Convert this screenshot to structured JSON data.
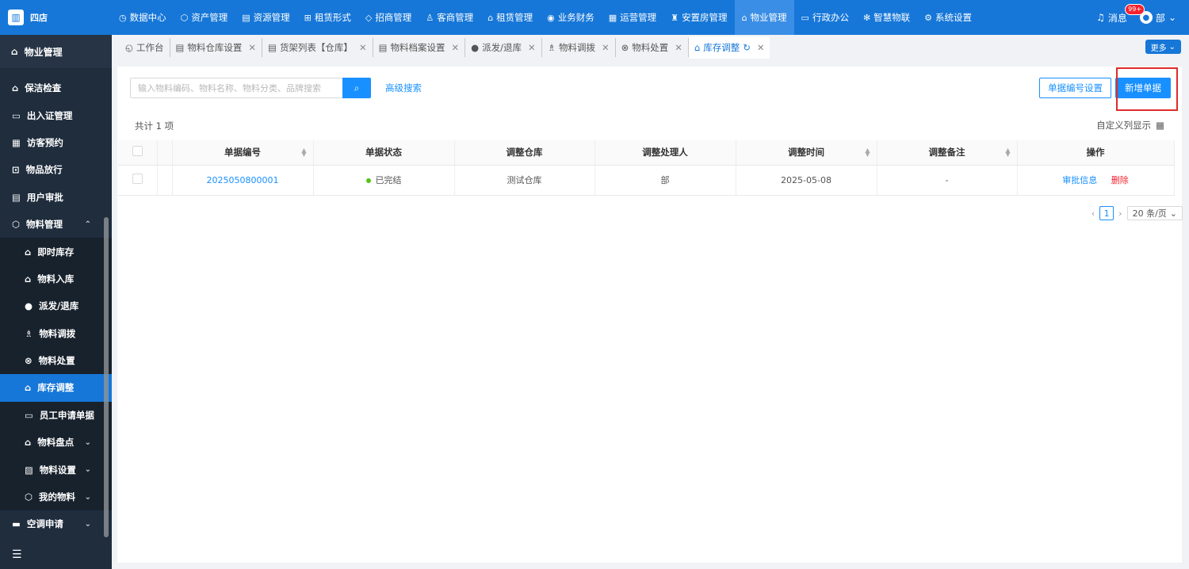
{
  "brand": {
    "name": "四店"
  },
  "nav": {
    "items": [
      {
        "icon": "◷",
        "label": "数据中心"
      },
      {
        "icon": "⬡",
        "label": "资产管理"
      },
      {
        "icon": "▤",
        "label": "资源管理"
      },
      {
        "icon": "⊞",
        "label": "租赁形式"
      },
      {
        "icon": "◇",
        "label": "招商管理"
      },
      {
        "icon": "♙",
        "label": "客商管理"
      },
      {
        "icon": "⌂",
        "label": "租赁管理"
      },
      {
        "icon": "◉",
        "label": "业务财务"
      },
      {
        "icon": "▦",
        "label": "运营管理"
      },
      {
        "icon": "♜",
        "label": "安置房管理"
      },
      {
        "icon": "⌂",
        "label": "物业管理"
      },
      {
        "icon": "▭",
        "label": "行政办公"
      },
      {
        "icon": "✻",
        "label": "智慧物联"
      },
      {
        "icon": "⚙",
        "label": "系统设置"
      }
    ],
    "message_label": "消息",
    "message_badge": "99+",
    "user_name": "部"
  },
  "sidebar": {
    "header": "物业管理",
    "items": [
      {
        "label": "保洁检查",
        "icon": "⌂"
      },
      {
        "label": "出入证管理",
        "icon": "▭"
      },
      {
        "label": "访客预约",
        "icon": "▦"
      },
      {
        "label": "物品放行",
        "icon": "⊡"
      },
      {
        "label": "用户审批",
        "icon": "▤"
      },
      {
        "label": "物料管理",
        "icon": "⬡",
        "chevron": "⌃"
      },
      {
        "label": "即时库存",
        "icon": "⌂"
      },
      {
        "label": "物料入库",
        "icon": "⌂"
      },
      {
        "label": "派发/退库",
        "icon": "●"
      },
      {
        "label": "物料调拨",
        "icon": "♗"
      },
      {
        "label": "物料处置",
        "icon": "⊗"
      },
      {
        "label": "库存调整",
        "icon": "⌂"
      },
      {
        "label": "员工申请单据",
        "icon": "▭"
      },
      {
        "label": "物料盘点",
        "icon": "⌂",
        "chevron": "⌄"
      },
      {
        "label": "物料设置",
        "icon": "▨",
        "chevron": "⌄"
      },
      {
        "label": "我的物料",
        "icon": "⬡",
        "chevron": "⌄"
      },
      {
        "label": "空调申请",
        "icon": "▬",
        "chevron": "⌄"
      }
    ],
    "collapse_icon": "☰"
  },
  "tabs": {
    "items": [
      {
        "icon": "◵",
        "label": "工作台"
      },
      {
        "icon": "▤",
        "label": "物料仓库设置",
        "close": "✕"
      },
      {
        "icon": "▤",
        "label": "货架列表【仓库】",
        "close": "✕"
      },
      {
        "icon": "▤",
        "label": "物料档案设置",
        "close": "✕"
      },
      {
        "icon": "●",
        "label": "派发/退库",
        "close": "✕"
      },
      {
        "icon": "♗",
        "label": "物料调拨",
        "close": "✕"
      },
      {
        "icon": "⊗",
        "label": "物料处置",
        "close": "✕"
      },
      {
        "icon": "⌂",
        "label": "库存调整",
        "refresh": "↻",
        "close": "✕"
      }
    ],
    "more_label": "更多"
  },
  "toolbar": {
    "search_placeholder": "输入物料编码、物料名称、物料分类、品牌搜索",
    "advanced_search": "高级搜索",
    "number_setting": "单据编号设置",
    "add_doc": "新增单据"
  },
  "summary": {
    "total": "共计 1 项",
    "custom_columns": "自定义列显示"
  },
  "table": {
    "columns": [
      "单据编号",
      "单据状态",
      "调整仓库",
      "调整处理人",
      "调整时间",
      "调整备注",
      "操作"
    ],
    "rows": [
      {
        "doc_no": "2025050800001",
        "status": "已完结",
        "warehouse": "测试仓库",
        "handler": "部",
        "time": "2025-05-08",
        "remark": "-",
        "action_view": "审批信息",
        "action_delete": "删除"
      }
    ]
  },
  "pagination": {
    "current_page": "1",
    "page_size": "20 条/页"
  }
}
